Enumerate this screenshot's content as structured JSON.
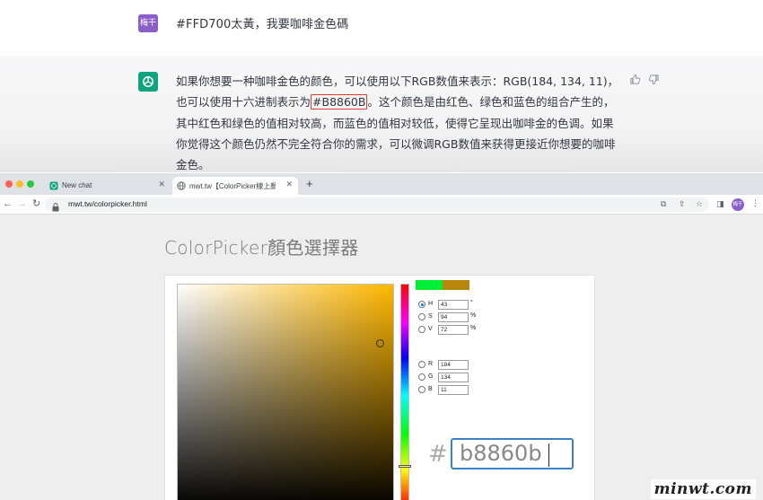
{
  "chat": {
    "user_avatar": "梅干",
    "user_message": "#FFD700太黃，我要咖啡金色碼",
    "bot_text_before": "如果你想要一种咖啡金色的颜色，可以使用以下RGB数值来表示：RGB(184, 134, 11)，也可以使用十六进制表示为",
    "bot_highlight": "#B8860B",
    "bot_text_after": "。这个颜色是由红色、绿色和蓝色的组合产生的，其中红色和绿色的值相对较高，而蓝色的值相对较低，使得它呈现出咖啡金的色调。如果你觉得这个颜色仍然不完全符合你的需求，可以微调RGB数值来获得更接近你想要的咖啡金色。",
    "icons": {
      "bot": "openai-logo-icon",
      "like": "thumbs-up-icon",
      "dislike": "thumbs-down-icon"
    }
  },
  "browser": {
    "tabs": [
      {
        "label": "New chat",
        "icon": "chat-favicon"
      },
      {
        "label": "mwt.tw【ColorPicker線上顏色選擇器】",
        "icon": "globe-icon"
      }
    ],
    "url": "mwt.tw/colorpicker.html",
    "profile_label": "梅干"
  },
  "colorpicker": {
    "title": "ColorPicker顏色選擇器",
    "selected_mode": "H",
    "hsv": [
      {
        "label": "H",
        "value": "43",
        "unit": "°"
      },
      {
        "label": "S",
        "value": "94",
        "unit": "%"
      },
      {
        "label": "V",
        "value": "72",
        "unit": "%"
      }
    ],
    "rgb": [
      {
        "label": "R",
        "value": "184"
      },
      {
        "label": "G",
        "value": "134"
      },
      {
        "label": "B",
        "value": "11"
      }
    ],
    "hash_symbol": "#",
    "hex_value": "b8860b",
    "new_color": "#00ee33",
    "current_color": "#b8860b",
    "hue_base_color": "#ffb700"
  },
  "watermark": "minwt.com",
  "colors": {
    "highlight_border": "#e03b2f",
    "openai_green": "#10a37f",
    "user_avatar": "#8b5fc9"
  }
}
